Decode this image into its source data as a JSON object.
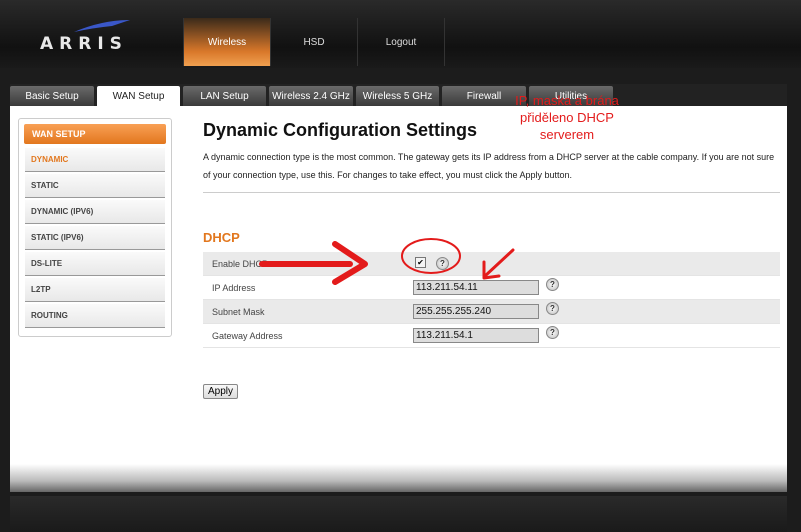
{
  "header": {
    "logo_text": "ARRIS",
    "nav": [
      {
        "label": "Wireless",
        "active": true
      },
      {
        "label": "HSD",
        "active": false
      },
      {
        "label": "Logout",
        "active": false
      }
    ]
  },
  "tabs": [
    {
      "label": "Basic Setup",
      "active": false
    },
    {
      "label": "WAN Setup",
      "active": true
    },
    {
      "label": "LAN Setup",
      "active": false
    },
    {
      "label": "Wireless 2.4 GHz",
      "active": false
    },
    {
      "label": "Wireless 5 GHz",
      "active": false
    },
    {
      "label": "Firewall",
      "active": false
    },
    {
      "label": "Utilities",
      "active": false
    }
  ],
  "sidebar": {
    "title": "WAN SETUP",
    "items": [
      {
        "label": "DYNAMIC",
        "active": true
      },
      {
        "label": "STATIC",
        "active": false
      },
      {
        "label": "DYNAMIC (IPV6)",
        "active": false
      },
      {
        "label": "STATIC (IPV6)",
        "active": false
      },
      {
        "label": "DS-LITE",
        "active": false
      },
      {
        "label": "L2TP",
        "active": false
      },
      {
        "label": "ROUTING",
        "active": false
      }
    ]
  },
  "main": {
    "title": "Dynamic Configuration Settings",
    "description": "A dynamic connection type is the most common. The gateway gets its IP address from a DHCP server at the cable company. If you are not sure of your connection type, use this. For changes to take effect, you must click the Apply button.",
    "section_title": "DHCP",
    "enable_dhcp_label": "Enable DHCP",
    "enable_dhcp_checked": true,
    "checkbox_mark": "✔",
    "help_glyph": "?",
    "ip_label": "IP Address",
    "ip_value": "113.211.54.11",
    "mask_label": "Subnet Mask",
    "mask_value": "255.255.255.240",
    "gateway_label": "Gateway Address",
    "gateway_value": "113.211.54.1",
    "apply_label": "Apply"
  },
  "annotation": {
    "lines": [
      "IP, maska a brána",
      "přiděleno DHCP",
      "serverem"
    ],
    "color": "#e31b1b"
  },
  "colors": {
    "accent": "#e2771e"
  }
}
